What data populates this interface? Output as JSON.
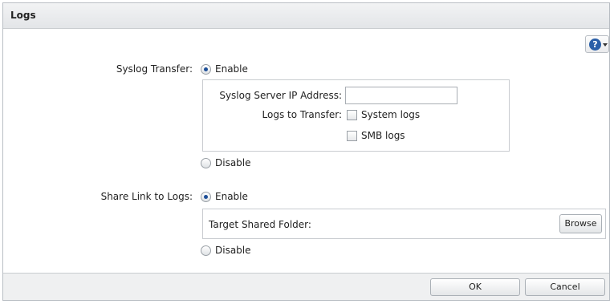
{
  "dialog": {
    "title": "Logs"
  },
  "help": {
    "glyph": "?"
  },
  "syslog": {
    "label": "Syslog Transfer:",
    "enable_label": "Enable",
    "enabled": true,
    "server_ip_label": "Syslog Server IP Address:",
    "server_ip_value": "",
    "logs_label": "Logs to Transfer:",
    "system_logs_label": "System logs",
    "system_logs_checked": false,
    "smb_logs_label": "SMB logs",
    "smb_logs_checked": false,
    "disable_label": "Disable"
  },
  "share_link": {
    "label": "Share Link to Logs:",
    "enable_label": "Enable",
    "enabled": true,
    "target_label": "Target Shared Folder:",
    "browse_label": "Browse",
    "disable_label": "Disable"
  },
  "footer": {
    "ok_label": "OK",
    "cancel_label": "Cancel"
  },
  "colors": {
    "accent": "#1e4f98",
    "help_icon": "#2a5fa8"
  }
}
